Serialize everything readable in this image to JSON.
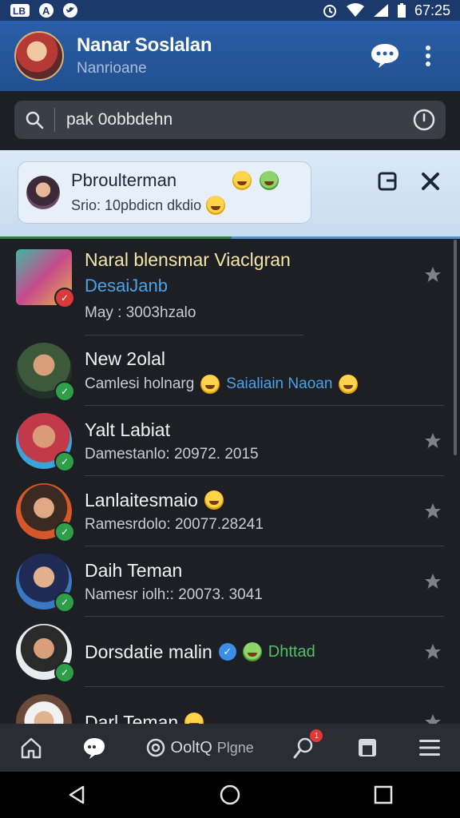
{
  "status_bar": {
    "left_icons": [
      "app-icon-1",
      "app-icon-2",
      "twitter-icon"
    ],
    "time": "67:25"
  },
  "header": {
    "title": "Nanar Soslalan",
    "subtitle": "Nanrioane"
  },
  "search": {
    "value": "pak 0obbdehn"
  },
  "pinned": {
    "name": "Pbroulterman",
    "message": "Srio: 10pbdicn dkdio"
  },
  "chats": [
    {
      "name": "Naral blensmar Viaclgran",
      "line2": "DesaiJanb",
      "line3": "May : 3003hzalo"
    },
    {
      "name": "New 2olal",
      "line2": "Camlesi holnarg",
      "line2b": "Saialiain Naoan"
    },
    {
      "name": "Yalt Labiat",
      "line2": "Damestanlo: 20972. 2015"
    },
    {
      "name": "Lanlaitesmaio",
      "line2": "Ramesrdolo: 20077.28241"
    },
    {
      "name": "Daih Teman",
      "line2": "Namesr iolh:: 20073. 3041"
    },
    {
      "name": "Dorsdatie malin",
      "line2b": "Dhttad"
    },
    {
      "name": "Darl Teman"
    }
  ],
  "bottom_nav": {
    "middle_a": "OoltQ",
    "middle_b": "Plgne",
    "notif_count": "1"
  },
  "colors": {
    "appbar": "#2a5ea8",
    "background": "#1d1f24",
    "accent_blue": "#4aa3e6",
    "accent_green": "#4fc06a"
  }
}
